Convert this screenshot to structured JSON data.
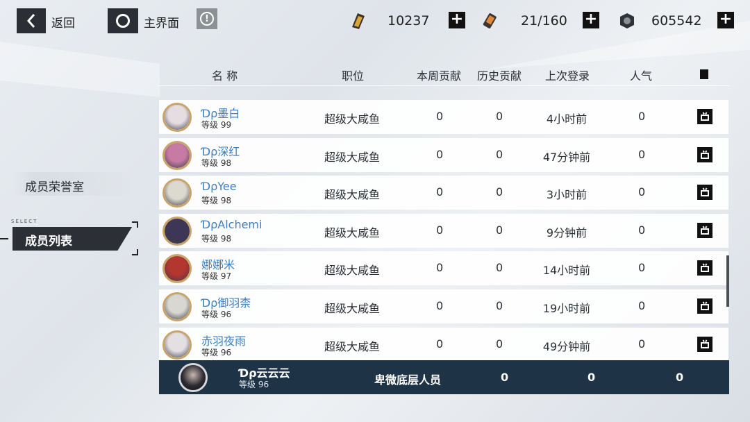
{
  "topbar": {
    "back_label": "返回",
    "home_label": "主界面",
    "info_symbol": "!",
    "resources": [
      {
        "icon": "ration-box-icon",
        "value": "10237"
      },
      {
        "icon": "battery-icon",
        "value": "21/160"
      },
      {
        "icon": "gear-nut-icon",
        "value": "605542"
      }
    ],
    "plus_symbol": "+"
  },
  "side_menu": {
    "honor_room": "成员荣誉室",
    "select_tag": "SELECT",
    "member_list": "成员列表"
  },
  "table": {
    "headers": {
      "name": "名 称",
      "position": "职位",
      "weekly": "本周贡献",
      "history": "历史贡献",
      "last_login": "上次登录",
      "popularity": "人气"
    },
    "rows": [
      {
        "name": "Ɗρ墨白",
        "level": "等级 99",
        "position": "超级大咸鱼",
        "weekly": "0",
        "history": "0",
        "last_login": "4小时前",
        "popularity": "0",
        "avatar_color": "#e6dde2"
      },
      {
        "name": "Ɗρ深红",
        "level": "等级 98",
        "position": "超级大咸鱼",
        "weekly": "0",
        "history": "0",
        "last_login": "47分钟前",
        "popularity": "0",
        "avatar_color": "#c77aa3"
      },
      {
        "name": "ƊρYee",
        "level": "等级 98",
        "position": "超级大咸鱼",
        "weekly": "0",
        "history": "0",
        "last_login": "3小时前",
        "popularity": "0",
        "avatar_color": "#dcd9cf"
      },
      {
        "name": "ƊρAlchemi",
        "level": "等级 98",
        "position": "超级大咸鱼",
        "weekly": "0",
        "history": "0",
        "last_login": "9分钟前",
        "popularity": "0",
        "avatar_color": "#3d3656"
      },
      {
        "name": "娜娜米",
        "level": "等级 97",
        "position": "超级大咸鱼",
        "weekly": "0",
        "history": "0",
        "last_login": "14小时前",
        "popularity": "0",
        "avatar_color": "#b3362f"
      },
      {
        "name": "Ɗρ御羽柰",
        "level": "等级 96",
        "position": "超级大咸鱼",
        "weekly": "0",
        "history": "0",
        "last_login": "19小时前",
        "popularity": "0",
        "avatar_color": "#d9d7d1"
      },
      {
        "name": "赤羽夜雨",
        "level": "等级 96",
        "position": "超级大咸鱼",
        "weekly": "0",
        "history": "0",
        "last_login": "49分钟前",
        "popularity": "0",
        "avatar_color": "#e4dfe3"
      }
    ]
  },
  "self_row": {
    "name": "Ɗρ云云云",
    "level": "等级 96",
    "position": "卑微底层人员",
    "weekly": "0",
    "history": "0",
    "popularity": "0",
    "avatar_color": "#2d2a33"
  },
  "colors": {
    "name_blue": "#3d7fc1",
    "self_row_bg": "#1f3347",
    "avatar_border": "#c9a46a"
  }
}
